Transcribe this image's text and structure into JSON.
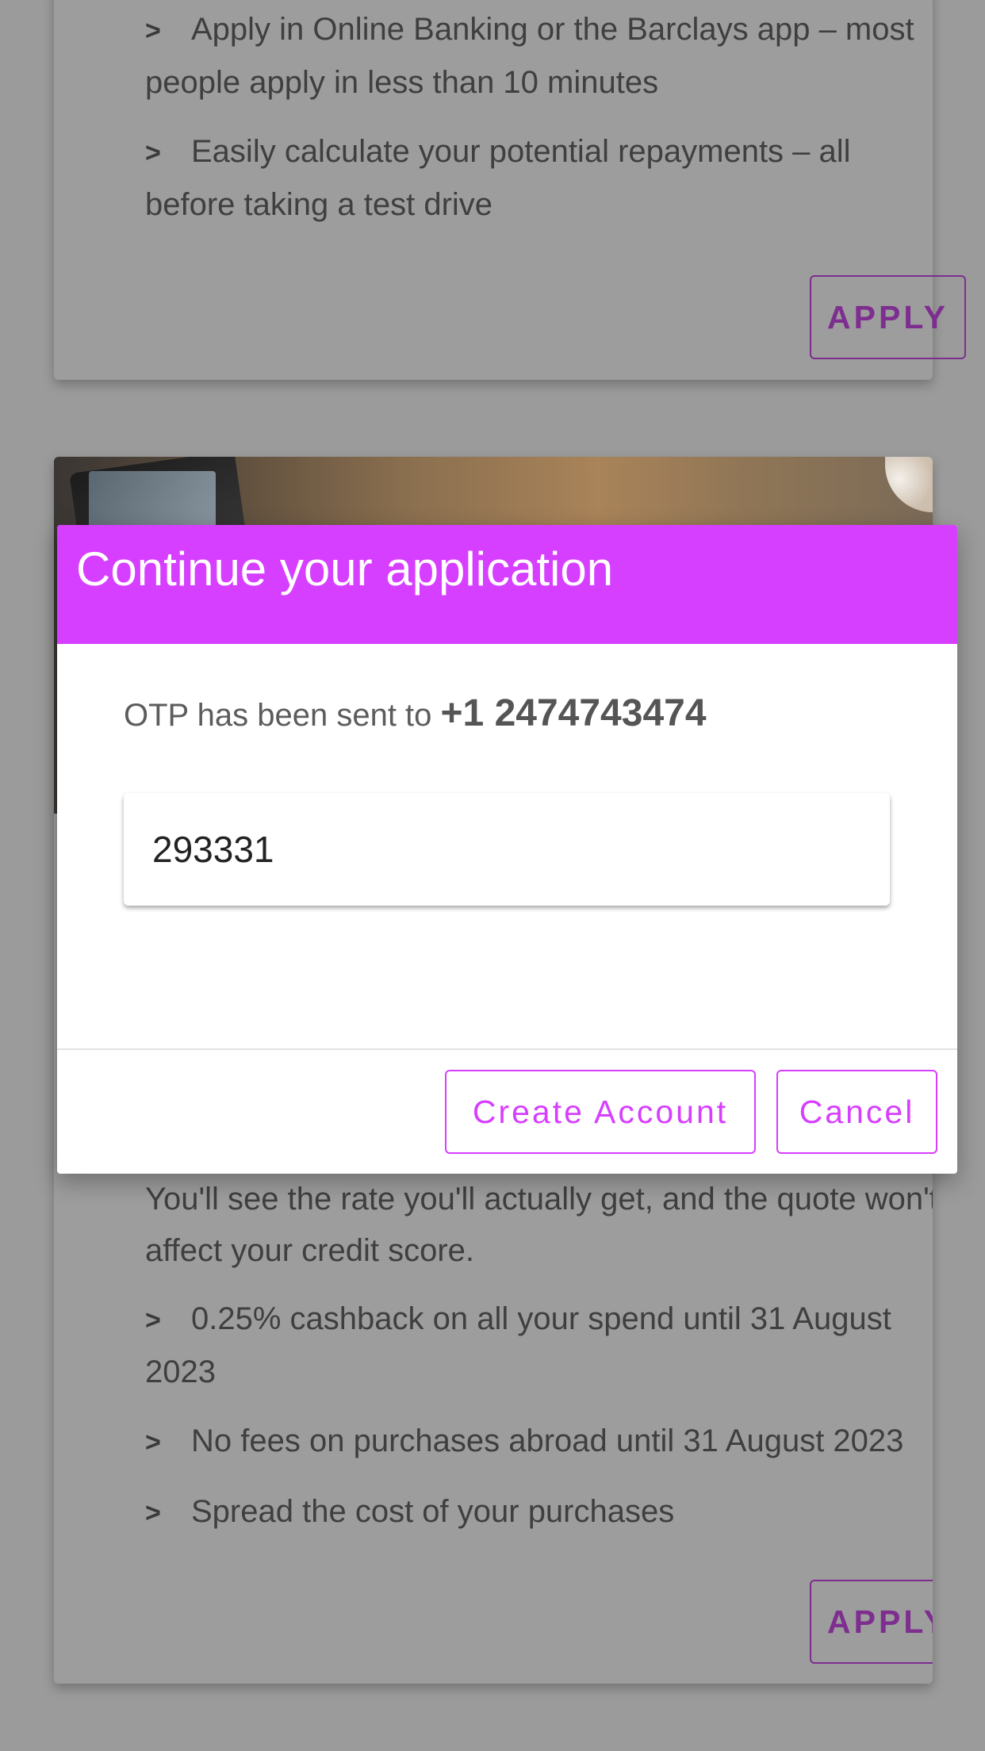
{
  "card_top": {
    "bullets": [
      "Apply in Online Banking or the Barclays app – most people apply in less than 10 minutes",
      "Easily calculate your potential repayments – all before taking a test drive"
    ],
    "apply_label": "APPLY"
  },
  "card_bottom": {
    "intro_text": "You'll see the rate you'll actually get, and the quote won't affect your credit score.",
    "bullets": [
      "0.25% cashback on all your spend until 31 August 2023",
      "No fees on purchases abroad until 31 August 2023",
      "Spread the cost of your purchases"
    ],
    "apply_label": "APPLY"
  },
  "bullet_marker": ">",
  "dialog": {
    "title": "Continue your application",
    "otp_prefix": "OTP has been sent to ",
    "otp_phone": "+1 2474743474",
    "otp_value": "293331",
    "create_label": "Create Account",
    "cancel_label": "Cancel"
  },
  "colors": {
    "accent": "#d63fff",
    "apply_outline": "#7d2e8f",
    "overlay_bg": "#9b9b9b"
  }
}
